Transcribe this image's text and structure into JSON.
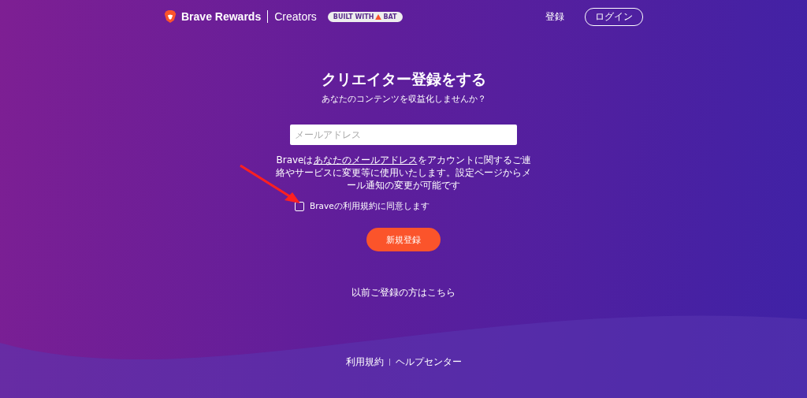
{
  "header": {
    "brand": "Brave Rewards",
    "section": "Creators",
    "badge": {
      "prefix": "BUILT WITH",
      "token": "BAT"
    },
    "nav": [
      {
        "label": "登録",
        "kind": "link"
      },
      {
        "label": "ログイン",
        "kind": "outlined"
      }
    ]
  },
  "form": {
    "title": "クリエイター登録をする",
    "subtitle": "あなたのコンテンツを収益化しませんか？",
    "email": {
      "placeholder": "メールアドレス"
    },
    "note": {
      "before": "Braveは",
      "link": "あなたのメールアドレス",
      "after": "をアカウントに関するご連絡やサービスに変更等に使用いたします。設定ページからメール通知の変更が可能です"
    },
    "terms": {
      "label": "Braveの利用規約に同意します",
      "checked": false
    },
    "submit": "新規登録",
    "login_link": "以前ご登録の方はこちら"
  },
  "footer": {
    "links": [
      "利用規約",
      "ヘルプセンター"
    ]
  }
}
